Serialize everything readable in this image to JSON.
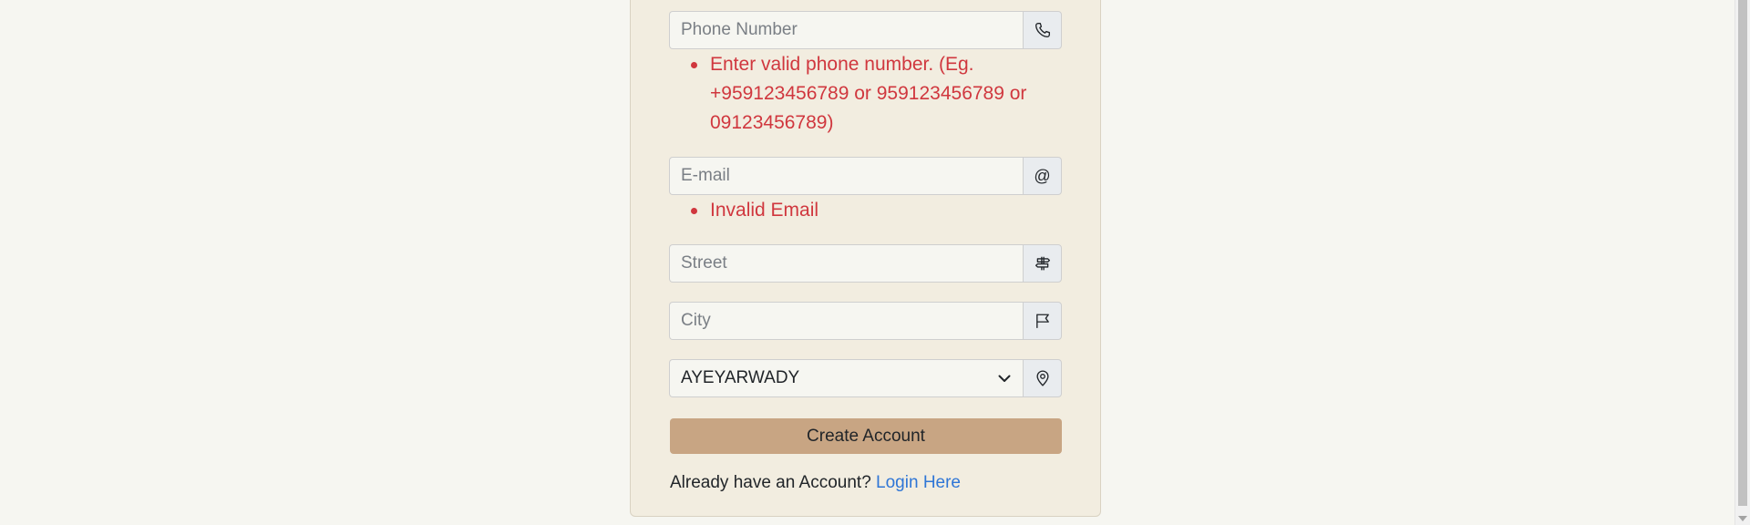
{
  "form": {
    "phone": {
      "placeholder": "Phone Number",
      "value": "",
      "icon": "phone-icon",
      "errors": [
        "Enter valid phone number. (Eg. +959123456789 or 959123456789 or 09123456789)"
      ]
    },
    "email": {
      "placeholder": "E-mail",
      "value": "",
      "addon_text": "@",
      "errors": [
        "Invalid Email"
      ]
    },
    "street": {
      "placeholder": "Street",
      "value": "",
      "icon": "signpost-icon"
    },
    "city": {
      "placeholder": "City",
      "value": "",
      "icon": "flag-icon"
    },
    "region": {
      "selected": "AYEYARWADY",
      "icon": "map-pin-icon"
    },
    "submit_label": "Create Account",
    "footer": {
      "prompt": "Already have an Account?",
      "link_label": "Login Here"
    }
  },
  "colors": {
    "error": "#d0373e",
    "button": "#c8a583",
    "link": "#2f76d6",
    "card_bg": "#f2ede0",
    "page_bg": "#f6f6f1"
  }
}
